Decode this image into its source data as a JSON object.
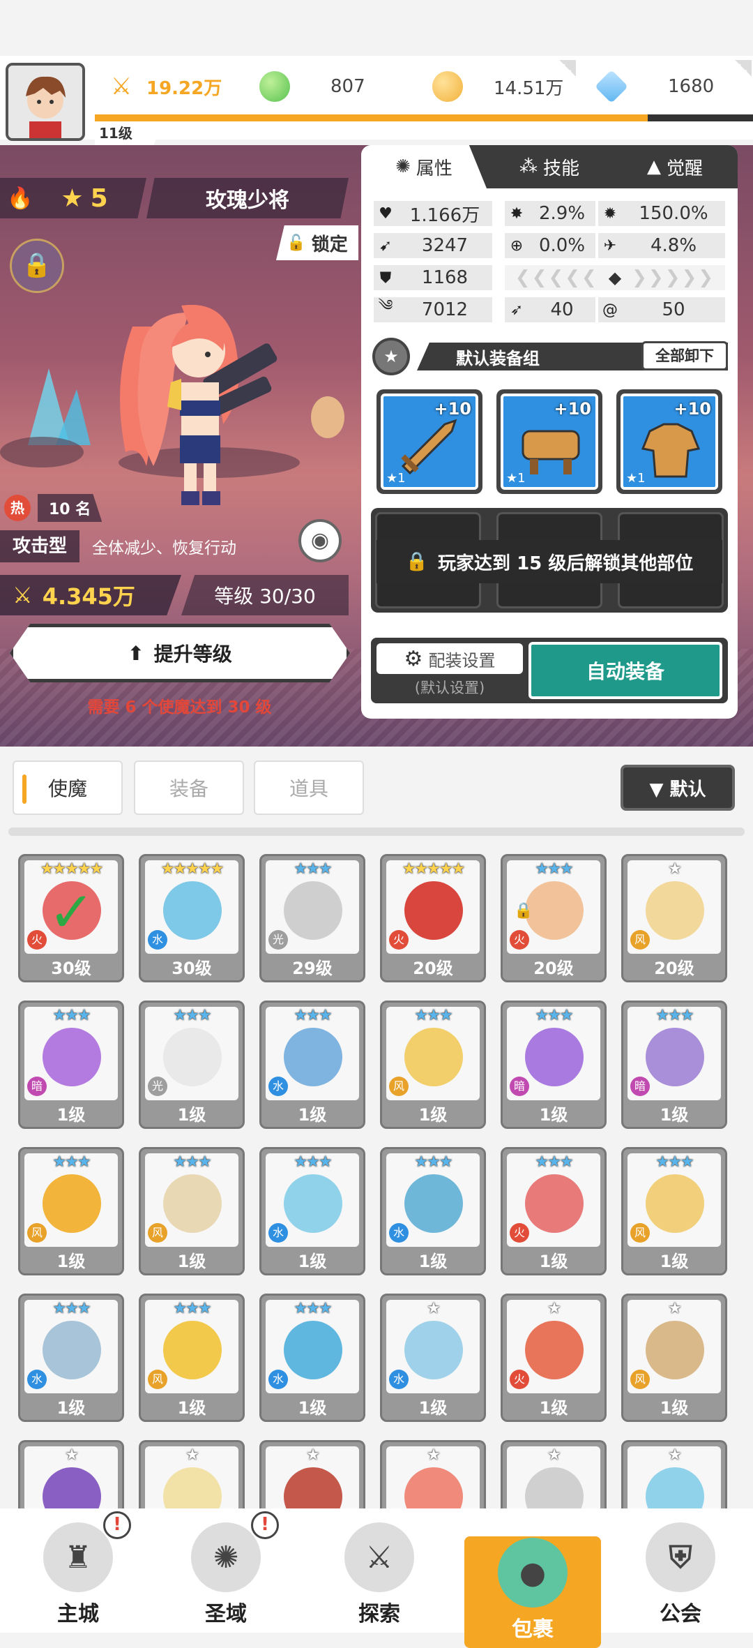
{
  "top": {
    "level": "11级",
    "resources": [
      {
        "icon": "sword-power-icon",
        "value": "19.22万",
        "color": "#f5a623"
      },
      {
        "icon": "green-gem-icon",
        "value": "807",
        "color": "#58c24f"
      },
      {
        "icon": "gold-coin-icon",
        "value": "14.51万",
        "color": "#f2b13a"
      },
      {
        "icon": "blue-crystal-icon",
        "value": "1680",
        "color": "#5fb6f2"
      }
    ],
    "xp_fraction": 0.84
  },
  "hero": {
    "stars": "5",
    "name": "玫瑰少将",
    "lock": "锁定",
    "rank_hot": "热",
    "rank": "10 名",
    "type": "攻击型",
    "desc": "全体减少、恢复行动",
    "power": "4.345万",
    "level": "等级 30/30",
    "upgrade": "提升等级",
    "requirement": "需要 6 个使魔达到 30 级"
  },
  "info": {
    "tabs": [
      "属性",
      "技能",
      "觉醒"
    ],
    "stats": [
      {
        "icon": "heart-icon",
        "value": "1.166万"
      },
      {
        "icon": "burst-icon",
        "value": "2.9%"
      },
      {
        "icon": "sun-icon",
        "value": "150.0%"
      },
      {
        "icon": "attack-icon",
        "value": "3247"
      },
      {
        "icon": "target-icon",
        "value": "0.0%"
      },
      {
        "icon": "speed-icon",
        "value": "4.8%"
      },
      {
        "icon": "shield-icon",
        "value": "1168"
      },
      {
        "icon": "wind-icon",
        "value": "7012"
      },
      {
        "icon": "bow-icon",
        "value": "40"
      },
      {
        "icon": "swirl-icon",
        "value": "50"
      }
    ],
    "equip_title": "默认装备组",
    "unequip_all": "全部卸下",
    "equip": [
      {
        "icon": "sword-icon",
        "plus": "+10",
        "star": "★1"
      },
      {
        "icon": "hat-icon",
        "plus": "+10",
        "star": "★1"
      },
      {
        "icon": "armor-icon",
        "plus": "+10",
        "star": "★1"
      }
    ],
    "locked_msg": "玩家达到 15 级后解锁其他部位",
    "config": "配装设置",
    "config_sub": "(默认设置)",
    "auto": "自动装备"
  },
  "filters": {
    "tabs": [
      "使魔",
      "装备",
      "道具"
    ],
    "sort": "▼ 默认"
  },
  "cards": [
    {
      "stars": "★★★★★",
      "star_color": "#ffd34d",
      "level": "30级",
      "bg": "#e86b6b",
      "elem": "fire",
      "selected": true
    },
    {
      "stars": "★★★★★",
      "star_color": "#ffd34d",
      "level": "30级",
      "bg": "#7fc9e8",
      "elem": "water"
    },
    {
      "stars": "★★★",
      "star_color": "#58b4ea",
      "level": "29级",
      "bg": "#cfcfcf",
      "elem": "light"
    },
    {
      "stars": "★★★★★",
      "star_color": "#ffd34d",
      "level": "20级",
      "bg": "#d9463d",
      "elem": "fire"
    },
    {
      "stars": "★★★",
      "star_color": "#58b4ea",
      "level": "20级",
      "bg": "#f2c39a",
      "elem": "fire",
      "locked": true
    },
    {
      "stars": "★",
      "star_color": "#ffffff",
      "level": "20级",
      "bg": "#f2d89a",
      "elem": "wind"
    },
    {
      "stars": "★★★",
      "star_color": "#58b4ea",
      "level": "1级",
      "bg": "#b37be0",
      "elem": "dark"
    },
    {
      "stars": "★★★",
      "star_color": "#58b4ea",
      "level": "1级",
      "bg": "#e9e9e9",
      "elem": "light"
    },
    {
      "stars": "★★★",
      "star_color": "#58b4ea",
      "level": "1级",
      "bg": "#7fb4e0",
      "elem": "water"
    },
    {
      "stars": "★★★",
      "star_color": "#58b4ea",
      "level": "1级",
      "bg": "#f2cf6a",
      "elem": "wind"
    },
    {
      "stars": "★★★",
      "star_color": "#58b4ea",
      "level": "1级",
      "bg": "#a97be0",
      "elem": "dark"
    },
    {
      "stars": "★★★",
      "star_color": "#58b4ea",
      "level": "1级",
      "bg": "#a98ed9",
      "elem": "dark"
    },
    {
      "stars": "★★★",
      "star_color": "#58b4ea",
      "level": "1级",
      "bg": "#f2b43a",
      "elem": "wind"
    },
    {
      "stars": "★★★",
      "star_color": "#58b4ea",
      "level": "1级",
      "bg": "#e8d9b4",
      "elem": "wind"
    },
    {
      "stars": "★★★",
      "star_color": "#58b4ea",
      "level": "1级",
      "bg": "#8fd2ea",
      "elem": "water"
    },
    {
      "stars": "★★★",
      "star_color": "#58b4ea",
      "level": "1级",
      "bg": "#6fb7d9",
      "elem": "water"
    },
    {
      "stars": "★★★",
      "star_color": "#58b4ea",
      "level": "1级",
      "bg": "#e87a7a",
      "elem": "fire"
    },
    {
      "stars": "★★★",
      "star_color": "#58b4ea",
      "level": "1级",
      "bg": "#f2cf7a",
      "elem": "wind"
    },
    {
      "stars": "★★★",
      "star_color": "#58b4ea",
      "level": "1级",
      "bg": "#a7c4d9",
      "elem": "water"
    },
    {
      "stars": "★★★",
      "star_color": "#58b4ea",
      "level": "1级",
      "bg": "#f2c94a",
      "elem": "wind"
    },
    {
      "stars": "★★★",
      "star_color": "#58b4ea",
      "level": "1级",
      "bg": "#5fb7e0",
      "elem": "water"
    },
    {
      "stars": "★",
      "star_color": "#ffffff",
      "level": "1级",
      "bg": "#9fd2ea",
      "elem": "water"
    },
    {
      "stars": "★",
      "star_color": "#ffffff",
      "level": "1级",
      "bg": "#e8745a",
      "elem": "fire"
    },
    {
      "stars": "★",
      "star_color": "#ffffff",
      "level": "1级",
      "bg": "#d9b98a",
      "elem": "wind"
    },
    {
      "stars": "★",
      "star_color": "#ffffff",
      "level": "",
      "bg": "#8a5fc4",
      "elem": ""
    },
    {
      "stars": "★",
      "star_color": "#ffffff",
      "level": "",
      "bg": "#f2e2a8",
      "elem": ""
    },
    {
      "stars": "★",
      "star_color": "#ffffff",
      "level": "",
      "bg": "#c4584a",
      "elem": ""
    },
    {
      "stars": "★",
      "star_color": "#ffffff",
      "level": "",
      "bg": "#f08a7a",
      "elem": ""
    },
    {
      "stars": "★",
      "star_color": "#ffffff",
      "level": "",
      "bg": "#d0d0d0",
      "elem": ""
    },
    {
      "stars": "★",
      "star_color": "#ffffff",
      "level": "",
      "bg": "#8fd2ea",
      "elem": ""
    }
  ],
  "nav": [
    {
      "label": "主城",
      "icon": "castle-icon",
      "alert": "!"
    },
    {
      "label": "圣域",
      "icon": "vortex-icon",
      "alert": "!"
    },
    {
      "label": "探索",
      "icon": "sword-stone-icon"
    },
    {
      "label": "包裹",
      "icon": "bag-icon",
      "active": true
    },
    {
      "label": "公会",
      "icon": "guild-helmet-icon"
    }
  ]
}
